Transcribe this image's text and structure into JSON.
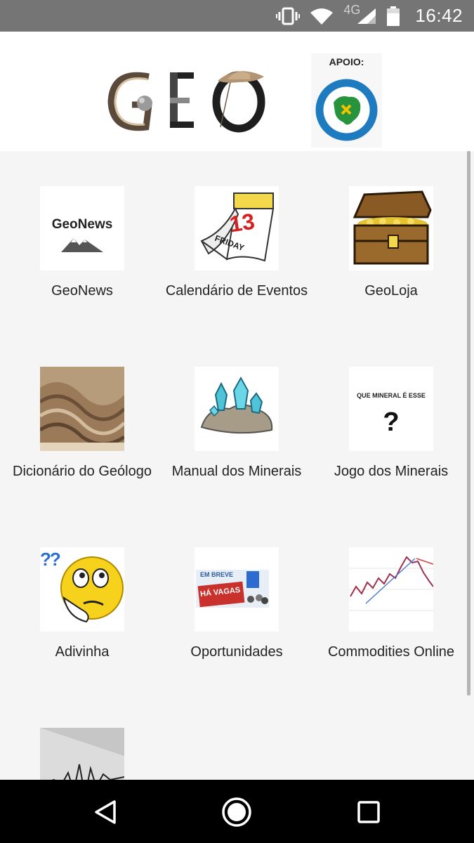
{
  "status_bar": {
    "network": "4G",
    "time": "16:42"
  },
  "header": {
    "logo_text": "GEO",
    "support_label": "APOIO:"
  },
  "tiles": [
    {
      "label": "GeoNews",
      "thumb_text": "GeoNews",
      "icon": "geonews-logo-icon"
    },
    {
      "label": "Calendário de Eventos",
      "thumb_text": "13",
      "thumb_sub": "FRIDAY",
      "icon": "calendar-icon"
    },
    {
      "label": "GeoLoja",
      "icon": "treasure-chest-icon"
    },
    {
      "label": "Dicionário do Geólogo",
      "icon": "rock-folds-photo"
    },
    {
      "label": "Manual dos Minerais",
      "icon": "crystals-icon"
    },
    {
      "label": "Jogo dos Minerais",
      "thumb_text": "QUE MINERAL É ESSE",
      "thumb_sub": "?",
      "icon": "question-mark-icon"
    },
    {
      "label": "Adivinha",
      "thumb_text": "??",
      "icon": "thinking-face-icon"
    },
    {
      "label": "Oportunidades",
      "thumb_text": "EM BREVE",
      "thumb_sub": "HÁ VAGAS",
      "icon": "jobs-icon"
    },
    {
      "label": "Commodities Online",
      "icon": "stock-chart-icon"
    },
    {
      "label": "",
      "icon": "seismograph-icon"
    }
  ],
  "nav": {
    "back": "back-icon",
    "home": "home-icon",
    "recents": "recents-icon"
  }
}
